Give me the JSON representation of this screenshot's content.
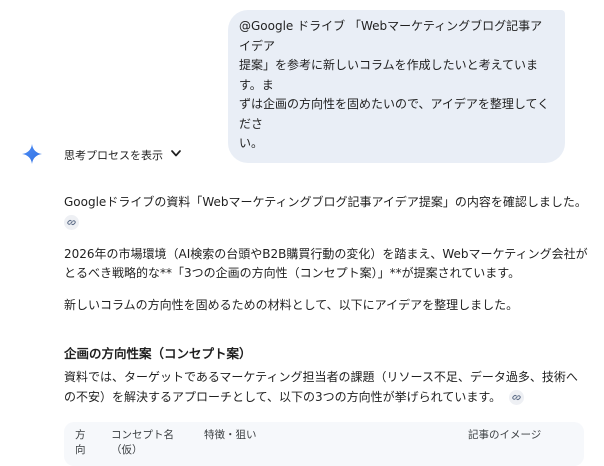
{
  "user_message": {
    "lines": [
      "@Google ドライブ 「Webマーケティングブログ記事アイデア",
      "提案」を参考に新しいコラムを作成したいと考えています。ま",
      "ずは企画の方向性を固めたいので、アイデアを整理してくださ",
      "い。"
    ]
  },
  "thoughts": {
    "label": "思考プロセスを表示",
    "chevron": "⌄"
  },
  "response": {
    "p1": "Googleドライブの資料「Webマーケティングブログ記事アイデア提案」の内容を確認しました。",
    "p2_line1": "2026年の市場環境（AI検索の台頭やB2B購買行動の変化）を踏まえ、Webマーケティング会社が",
    "p2_line2": "とるべき戦略的な**「3つの企画の方向性（コンセプト案）」**が提案されています。",
    "p3": "新しいコラムの方向性を固めるための材料として、以下にアイデアを整理しました。",
    "section_title": "企画の方向性案（コンセプト案）",
    "p4_line1": "資料では、ターゲットであるマーケティング担当者の課題（リソース不足、データ過多、技術へ",
    "p4_line2": "の不安）を解決するアプローチとして、以下の3つの方向性が挙げられています。"
  },
  "table": {
    "headers": {
      "direction_1": "方",
      "direction_2": "向",
      "concept_1": "コンセプト名",
      "concept_2": "（仮）",
      "features": "特徴・狙い",
      "image": "記事のイメージ"
    }
  },
  "icons": {
    "spark": "gemini-spark-icon",
    "link": "link-icon"
  },
  "colors": {
    "bubble": "#e9eef6",
    "spark_blue": "#3b7de9",
    "chip_bg": "#eef0f4"
  }
}
